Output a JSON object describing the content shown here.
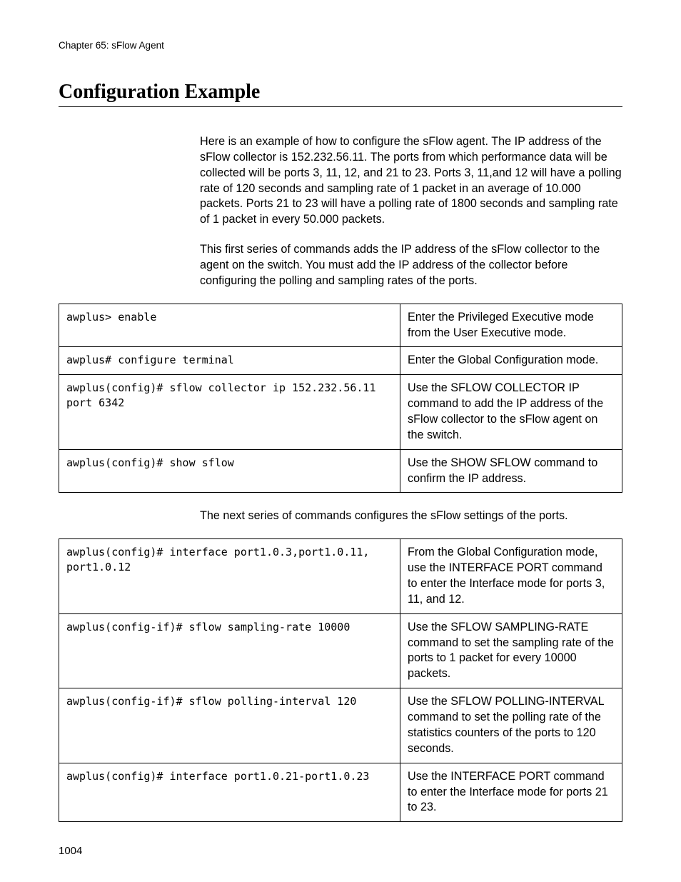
{
  "header": "Chapter 65: sFlow Agent",
  "title": "Configuration Example",
  "para1": "Here is an example of how to configure the sFlow agent. The IP address of the sFlow collector is 152.232.56.11. The ports from which performance data will be collected will be ports 3, 11, 12, and 21 to 23. Ports 3, 11,and 12 will have a polling rate of 120 seconds and sampling rate of 1 packet in an average of 10.000 packets. Ports 21 to 23 will have a polling rate of 1800 seconds and sampling rate of 1 packet in every 50.000 packets.",
  "para2": "This first series of commands adds the IP address of the sFlow collector to the agent on the switch. You must add the IP address of the collector before configuring the polling and sampling rates of the ports.",
  "table1": [
    {
      "cmd": "awplus> enable",
      "desc": "Enter the Privileged Executive mode from the User Executive mode."
    },
    {
      "cmd": "awplus# configure terminal",
      "desc": "Enter the Global Configuration mode."
    },
    {
      "cmd": "awplus(config)# sflow collector ip 152.232.56.11 port 6342",
      "desc": "Use the SFLOW COLLECTOR IP command to add the IP address of the sFlow collector to the sFlow agent on the switch."
    },
    {
      "cmd": "awplus(config)# show sflow",
      "desc": "Use the SHOW SFLOW command to confirm the IP address."
    }
  ],
  "para3": "The next series of commands configures the sFlow settings of the ports.",
  "table2": [
    {
      "cmd": "awplus(config)# interface port1.0.3,port1.0.11, port1.0.12",
      "desc": "From the Global Configuration mode, use the INTERFACE PORT command to enter the Interface mode for ports 3, 11, and 12."
    },
    {
      "cmd": "awplus(config-if)# sflow sampling-rate 10000",
      "desc": "Use the SFLOW SAMPLING-RATE command to set the sampling rate of the ports to 1 packet for every 10000 packets."
    },
    {
      "cmd": "awplus(config-if)# sflow polling-interval 120",
      "desc": "Use the SFLOW POLLING-INTERVAL command to set the polling rate of the statistics counters of the ports to 120 seconds."
    },
    {
      "cmd": "awplus(config)# interface port1.0.21-port1.0.23",
      "desc": "Use the INTERFACE PORT command to enter the Interface mode for ports 21 to 23."
    }
  ],
  "pagenum": "1004"
}
